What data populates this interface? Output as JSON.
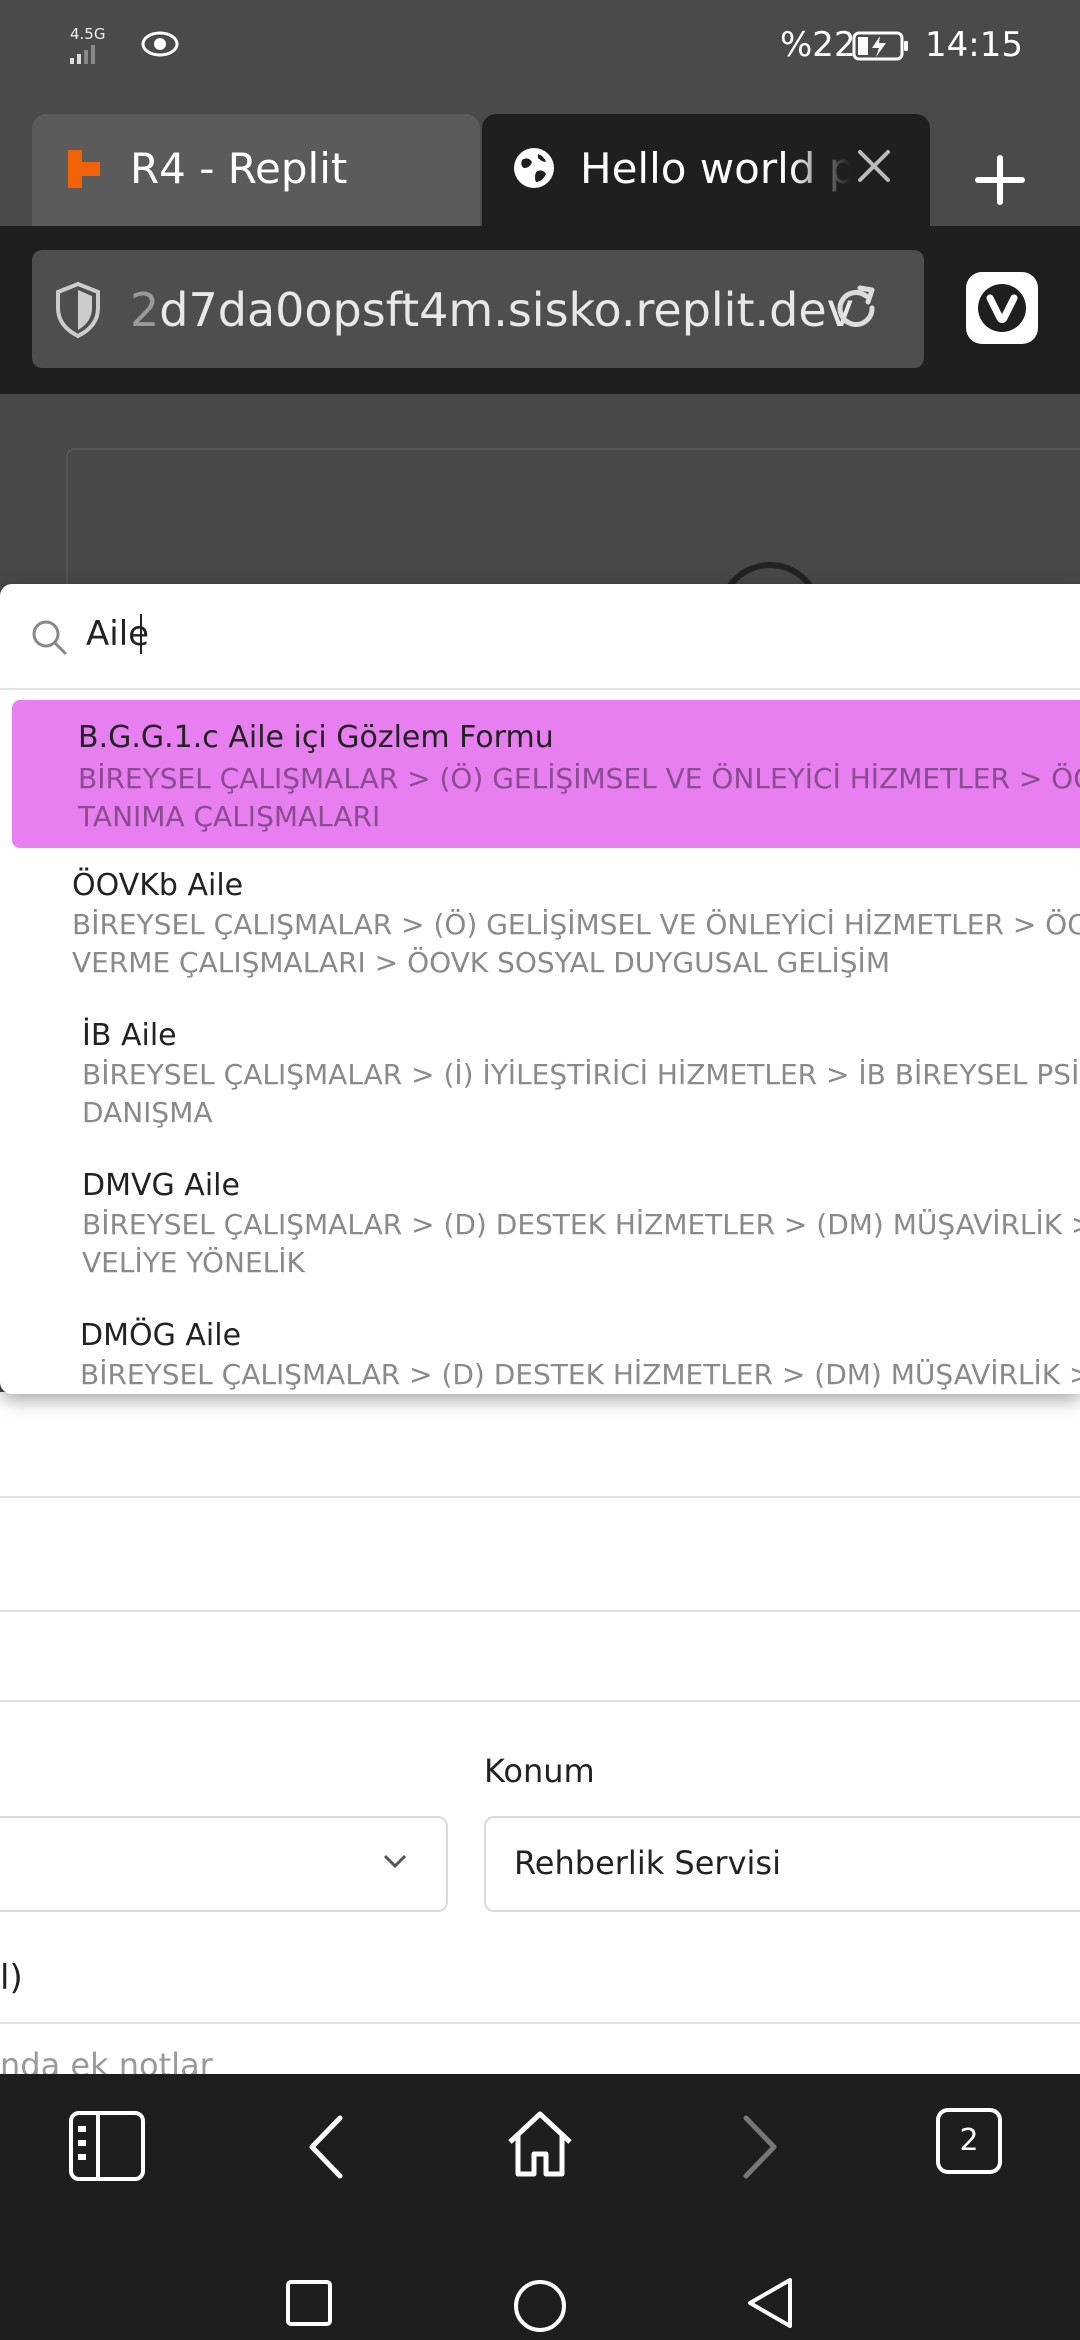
{
  "status_bar": {
    "network": "4.5G",
    "battery_percent": "%22",
    "time": "14:15"
  },
  "tabs": [
    {
      "label": "R4 - Replit",
      "icon": "replit-icon",
      "active": false
    },
    {
      "label": "Hello world project",
      "icon": "globe-icon",
      "active": true
    }
  ],
  "address_bar": {
    "url_prefix": "2",
    "url_rest": "d7da0opsft4m.sisko.replit.dev"
  },
  "dropdown": {
    "search_value": "Aile",
    "items": [
      {
        "title": "B.G.G.1.c Aile içi Gözlem Formu",
        "path_line1": "BİREYSEL ÇALIŞMALAR > (Ö) GELİŞİMSEL VE ÖNLEYİCİ HİZMETLER > ÖOB Bİ",
        "path_line2": "TANIMA ÇALIŞMALARI"
      },
      {
        "title": "ÖOVKb Aile",
        "path_line1": "BİREYSEL ÇALIŞMALAR > (Ö) GELİŞİMSEL VE ÖNLEYİCİ HİZMETLER > ÖOV BİL",
        "path_line2": "VERME ÇALIŞMALARI > ÖOVK SOSYAL DUYGUSAL GELİŞİM"
      },
      {
        "title": "İB Aile",
        "path_line1": "BİREYSEL ÇALIŞMALAR > (İ) İYİLEŞTİRİCİ HİZMETLER > İB BİREYSEL PSİKOLO.",
        "path_line2": "DANIŞMA"
      },
      {
        "title": "DMVG Aile",
        "path_line1": "BİREYSEL ÇALIŞMALAR > (D) DESTEK HİZMETLER > (DM) MÜŞAVİRLİK > DMV",
        "path_line2": "VELİYE YÖNELİK"
      },
      {
        "title": "DMÖG Aile",
        "path_line1": "BİREYSEL ÇALIŞMALAR > (D) DESTEK HİZMETLER > (DM) MÜŞAVİRLİK > DMÖ"
      }
    ]
  },
  "form": {
    "konum_label": "Konum",
    "konum_value": "Rehberlik Servisi",
    "partial_paren": "l)",
    "partial_notes": "nda ek notlar"
  },
  "bottom_nav": {
    "tab_count": "2"
  },
  "colors": {
    "highlight": "#e87ff0",
    "replit_orange": "#f26207"
  }
}
